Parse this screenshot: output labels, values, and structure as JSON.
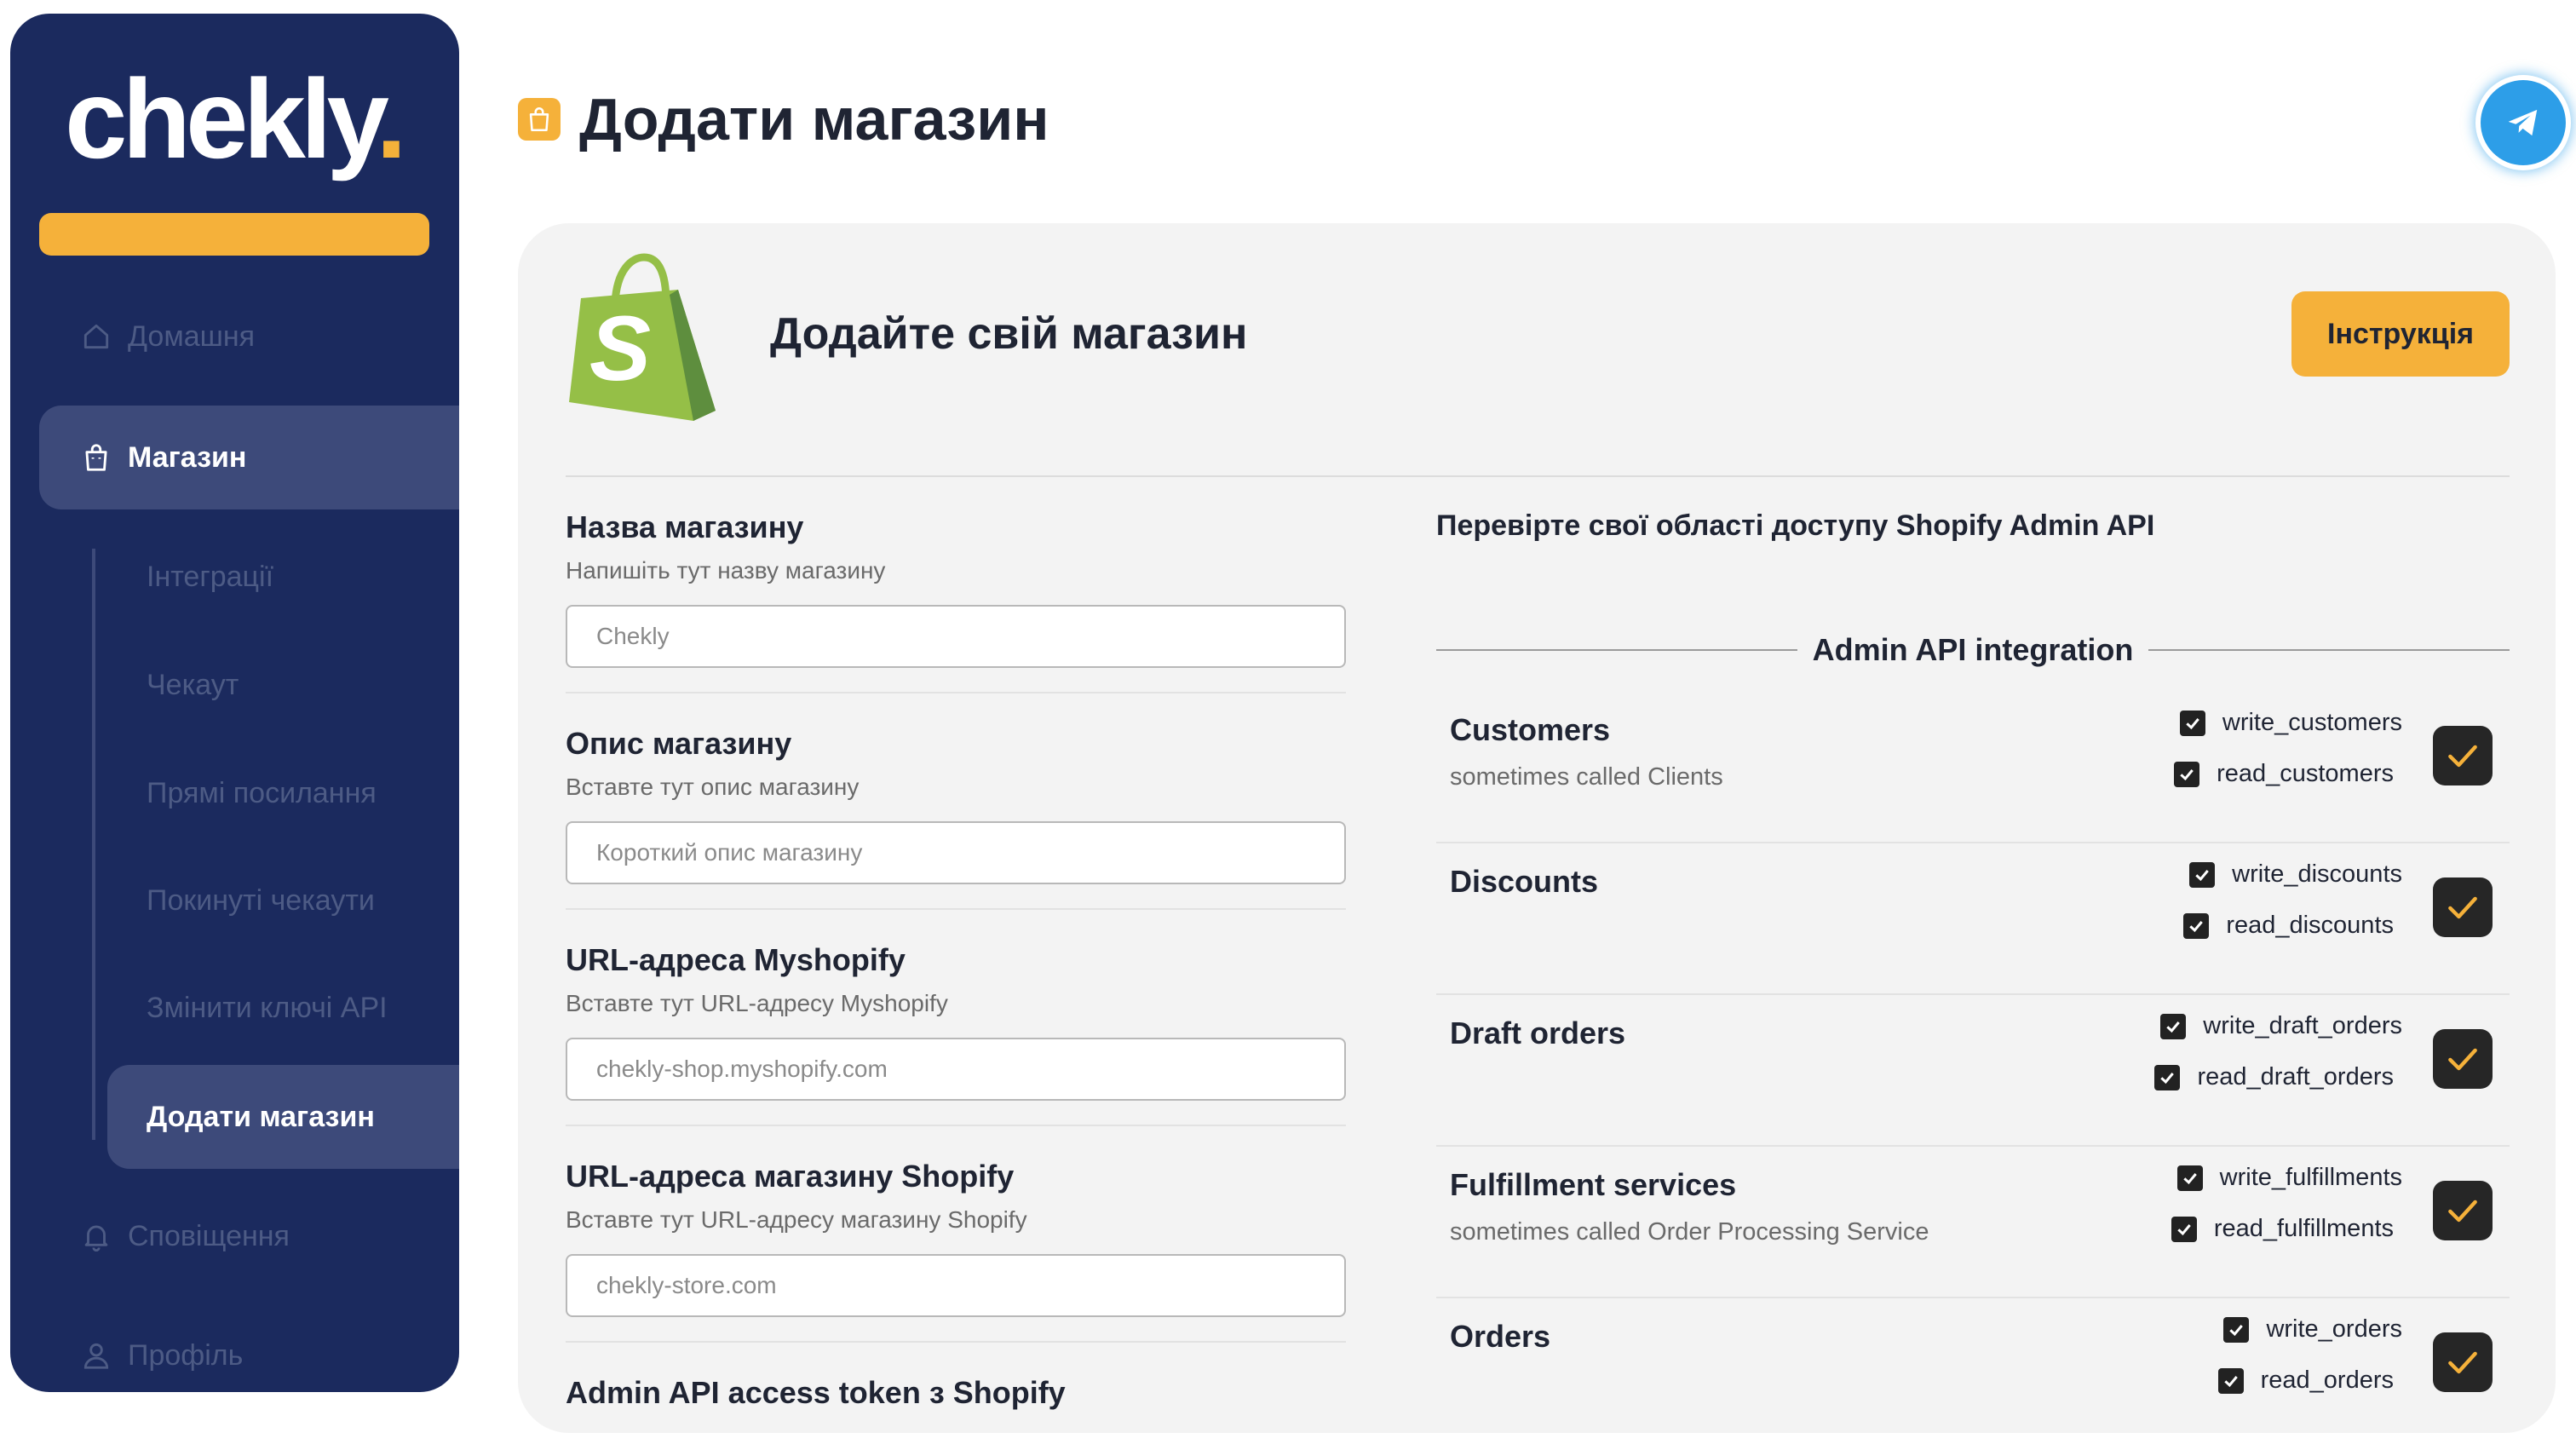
{
  "brand": {
    "logo_text": "chekly",
    "logo_dot": ".",
    "accent": "#f5b13a",
    "sidebar_bg": "#1b2a5e"
  },
  "sidebar": {
    "items": [
      {
        "label": "Домашня",
        "icon": "home-icon"
      },
      {
        "label": "Магазин",
        "icon": "shop-bag-icon",
        "active": true
      },
      {
        "label": "Сповіщення",
        "icon": "bell-icon"
      },
      {
        "label": "Профіль",
        "icon": "user-icon"
      }
    ],
    "sub_items": [
      {
        "label": "Інтеграції"
      },
      {
        "label": "Чекаут"
      },
      {
        "label": "Прямі посилання"
      },
      {
        "label": "Покинуті чекаути"
      },
      {
        "label": "Змінити ключі API"
      },
      {
        "label": "Додати магазин",
        "active": true
      }
    ]
  },
  "header": {
    "title": "Додати магазин",
    "icon": "shop-bag-icon",
    "telegram_icon": "telegram-icon"
  },
  "card": {
    "title": "Додайте свій магазин",
    "logo": "shopify-bag-logo",
    "instruction_button": "Інструкція"
  },
  "form": {
    "fields": [
      {
        "label": "Назва магазину",
        "help": "Напишіть тут назву магазину",
        "placeholder": "Chekly"
      },
      {
        "label": "Опис магазину",
        "help": "Вставте тут опис магазину",
        "placeholder": "Короткий опис магазину"
      },
      {
        "label": "URL-адреса Myshopify",
        "help": "Вставте тут URL-адресу Myshopify",
        "placeholder": "chekly-shop.myshopify.com"
      },
      {
        "label": "URL-адреса магазину Shopify",
        "help": "Вставте тут URL-адресу магазину Shopify",
        "placeholder": "chekly-store.com"
      },
      {
        "label": "Admin API access token з Shopify"
      }
    ]
  },
  "scopes": {
    "heading": "Перевірте свої області доступу Shopify Admin API",
    "integration_title": "Admin API integration",
    "rows": [
      {
        "name": "Customers",
        "desc": "sometimes called Clients",
        "write": "write_customers",
        "read": "read_customers"
      },
      {
        "name": "Discounts",
        "desc": "",
        "write": "write_discounts",
        "read": "read_discounts"
      },
      {
        "name": "Draft orders",
        "desc": "",
        "write": "write_draft_orders",
        "read": "read_draft_orders"
      },
      {
        "name": "Fulfillment services",
        "desc": "sometimes called Order Processing Service",
        "write": "write_fulfillments",
        "read": "read_fulfillments"
      },
      {
        "name": "Orders",
        "desc": "",
        "write": "write_orders",
        "read": "read_orders"
      }
    ]
  }
}
